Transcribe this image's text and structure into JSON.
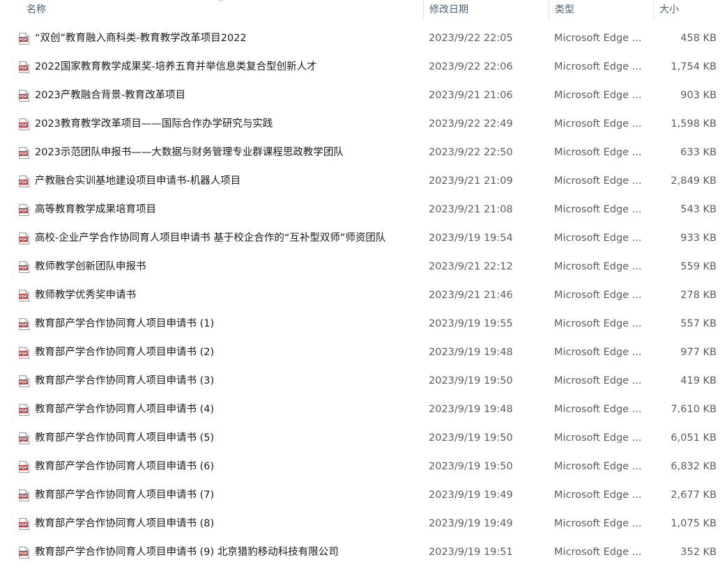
{
  "header": {
    "name": "名称",
    "date": "修改日期",
    "type": "类型",
    "size": "大小",
    "sort_glyph": "^"
  },
  "files": [
    {
      "name": "“双创”教育融入商科类-教育教学改革项目2022",
      "date": "2023/9/22 22:05",
      "type": "Microsoft Edge ...",
      "size": "458 KB"
    },
    {
      "name": "2022国家教育教学成果奖-培养五育并举信息类复合型创新人才",
      "date": "2023/9/22 22:06",
      "type": "Microsoft Edge ...",
      "size": "1,754 KB"
    },
    {
      "name": "2023产教融合背景-教育改革项目",
      "date": "2023/9/21 21:06",
      "type": "Microsoft Edge ...",
      "size": "903 KB"
    },
    {
      "name": "2023教育教学改革项目——国际合作办学研究与实践",
      "date": "2023/9/22 22:49",
      "type": "Microsoft Edge ...",
      "size": "1,598 KB"
    },
    {
      "name": "2023示范团队申报书——大数据与财务管理专业群课程思政教学团队",
      "date": "2023/9/22 22:50",
      "type": "Microsoft Edge ...",
      "size": "633 KB"
    },
    {
      "name": "产教融合实训基地建设项目申请书-机器人项目",
      "date": "2023/9/21 21:09",
      "type": "Microsoft Edge ...",
      "size": "2,849 KB"
    },
    {
      "name": "高等教育教学成果培育项目",
      "date": "2023/9/21 21:08",
      "type": "Microsoft Edge ...",
      "size": "543 KB"
    },
    {
      "name": "高校-企业产学合作协同育人项目申请书 基于校企合作的“互补型双师”师资团队",
      "date": "2023/9/19 19:54",
      "type": "Microsoft Edge ...",
      "size": "933 KB"
    },
    {
      "name": "教师教学创新团队申报书",
      "date": "2023/9/21 22:12",
      "type": "Microsoft Edge ...",
      "size": "559 KB"
    },
    {
      "name": "教师教学优秀奖申请书",
      "date": "2023/9/21 21:46",
      "type": "Microsoft Edge ...",
      "size": "278 KB"
    },
    {
      "name": "教育部产学合作协同育人项目申请书 (1)",
      "date": "2023/9/19 19:55",
      "type": "Microsoft Edge ...",
      "size": "557 KB"
    },
    {
      "name": "教育部产学合作协同育人项目申请书 (2)",
      "date": "2023/9/19 19:48",
      "type": "Microsoft Edge ...",
      "size": "977 KB"
    },
    {
      "name": "教育部产学合作协同育人项目申请书 (3)",
      "date": "2023/9/19 19:50",
      "type": "Microsoft Edge ...",
      "size": "419 KB"
    },
    {
      "name": "教育部产学合作协同育人项目申请书 (4)",
      "date": "2023/9/19 19:48",
      "type": "Microsoft Edge ...",
      "size": "7,610 KB"
    },
    {
      "name": "教育部产学合作协同育人项目申请书 (5)",
      "date": "2023/9/19 19:50",
      "type": "Microsoft Edge ...",
      "size": "6,051 KB"
    },
    {
      "name": "教育部产学合作协同育人项目申请书 (6)",
      "date": "2023/9/19 19:50",
      "type": "Microsoft Edge ...",
      "size": "6,832 KB"
    },
    {
      "name": "教育部产学合作协同育人项目申请书 (7)",
      "date": "2023/9/19 19:49",
      "type": "Microsoft Edge ...",
      "size": "2,677 KB"
    },
    {
      "name": "教育部产学合作协同育人项目申请书 (8)",
      "date": "2023/9/19 19:49",
      "type": "Microsoft Edge ...",
      "size": "1,075 KB"
    },
    {
      "name": "教育部产学合作协同育人项目申请书 (9) 北京猎豹移动科技有限公司",
      "date": "2023/9/19 19:51",
      "type": "Microsoft Edge ...",
      "size": "352 KB"
    }
  ],
  "colors": {
    "pdf_red": "#d0252b",
    "header_text": "#4c607a"
  },
  "icon": "pdf-file-icon",
  "icon_label": "PDF"
}
